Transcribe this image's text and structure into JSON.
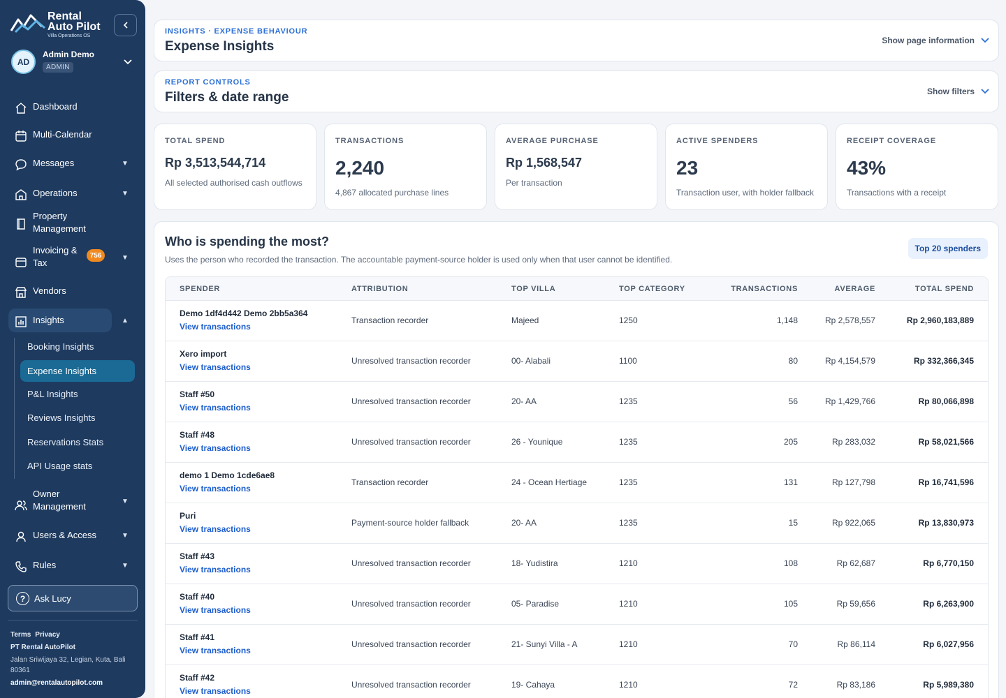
{
  "brand": {
    "line1": "Rental",
    "line2": "Auto Pilot",
    "tagline": "Villa Operations OS"
  },
  "user": {
    "initials": "AD",
    "name": "Admin Demo",
    "role": "ADMIN"
  },
  "nav": {
    "dashboard": "Dashboard",
    "multi_calendar": "Multi-Calendar",
    "messages": "Messages",
    "operations": "Operations",
    "property_management": "Property Management",
    "invoicing_line1": "Invoicing &",
    "invoicing_line2": "Tax",
    "invoicing_badge": "756",
    "vendors": "Vendors",
    "insights": "Insights",
    "owner_line1": "Owner",
    "owner_line2": "Management",
    "users_access": "Users & Access",
    "rules": "Rules",
    "caret_down": "▼",
    "caret_up": "▲"
  },
  "insights_sub": [
    "Booking Insights",
    "Expense Insights",
    "P&L Insights",
    "Reviews Insights",
    "Reservations Stats",
    "API Usage stats"
  ],
  "ask": {
    "icon": "?",
    "label": "Ask Lucy"
  },
  "footer": {
    "terms": "Terms",
    "privacy": "Privacy",
    "company": "PT Rental AutoPilot",
    "address": "Jalan Sriwijaya 32, Legian, Kuta, Bali 80361",
    "email": "admin@rentalautopilot.com"
  },
  "page": {
    "eyebrow": "INSIGHTS · EXPENSE BEHAVIOUR",
    "title": "Expense Insights",
    "info_toggle": "Show page information"
  },
  "filters": {
    "eyebrow": "REPORT CONTROLS",
    "title": "Filters & date range",
    "toggle": "Show filters"
  },
  "kpis": [
    {
      "label": "TOTAL SPEND",
      "value": "Rp 3,513,544,714",
      "sub": "All selected authorised cash outflows"
    },
    {
      "label": "TRANSACTIONS",
      "value": "2,240",
      "sub": "4,867 allocated purchase lines"
    },
    {
      "label": "AVERAGE PURCHASE",
      "value": "Rp 1,568,547",
      "sub": "Per transaction"
    },
    {
      "label": "ACTIVE SPENDERS",
      "value": "23",
      "sub": "Transaction user, with holder fallback"
    },
    {
      "label": "RECEIPT COVERAGE",
      "value": "43%",
      "sub": "Transactions with a receipt"
    }
  ],
  "spenders": {
    "title": "Who is spending the most?",
    "description": "Uses the person who recorded the transaction. The accountable payment-source holder is used only when that user cannot be identified.",
    "top_button": "Top 20 spenders",
    "link_label": "View transactions",
    "columns": [
      "SPENDER",
      "ATTRIBUTION",
      "TOP VILLA",
      "TOP CATEGORY",
      "TRANSACTIONS",
      "AVERAGE",
      "TOTAL SPEND"
    ],
    "rows": [
      {
        "spender": "Demo 1df4d442 Demo 2bb5a364",
        "attribution": "Transaction recorder",
        "villa": "Majeed",
        "category": "1250",
        "transactions": "1,148",
        "average": "Rp 2,578,557",
        "total": "Rp 2,960,183,889"
      },
      {
        "spender": "Xero import",
        "attribution": "Unresolved transaction recorder",
        "villa": "00- Alabali",
        "category": "1100",
        "transactions": "80",
        "average": "Rp 4,154,579",
        "total": "Rp 332,366,345"
      },
      {
        "spender": "Staff #50",
        "attribution": "Unresolved transaction recorder",
        "villa": "20- AA",
        "category": "1235",
        "transactions": "56",
        "average": "Rp 1,429,766",
        "total": "Rp 80,066,898"
      },
      {
        "spender": "Staff #48",
        "attribution": "Unresolved transaction recorder",
        "villa": "26 - Younique",
        "category": "1235",
        "transactions": "205",
        "average": "Rp 283,032",
        "total": "Rp 58,021,566"
      },
      {
        "spender": "demo 1 Demo 1cde6ae8",
        "attribution": "Transaction recorder",
        "villa": "24 - Ocean Hertiage",
        "category": "1235",
        "transactions": "131",
        "average": "Rp 127,798",
        "total": "Rp 16,741,596"
      },
      {
        "spender": "Puri",
        "attribution": "Payment-source holder fallback",
        "villa": "20- AA",
        "category": "1235",
        "transactions": "15",
        "average": "Rp 922,065",
        "total": "Rp 13,830,973"
      },
      {
        "spender": "Staff #43",
        "attribution": "Unresolved transaction recorder",
        "villa": "18- Yudistira",
        "category": "1210",
        "transactions": "108",
        "average": "Rp 62,687",
        "total": "Rp 6,770,150"
      },
      {
        "spender": "Staff #40",
        "attribution": "Unresolved transaction recorder",
        "villa": "05- Paradise",
        "category": "1210",
        "transactions": "105",
        "average": "Rp 59,656",
        "total": "Rp 6,263,900"
      },
      {
        "spender": "Staff #41",
        "attribution": "Unresolved transaction recorder",
        "villa": "21- Sunyi Villa - A",
        "category": "1210",
        "transactions": "70",
        "average": "Rp 86,114",
        "total": "Rp 6,027,956"
      },
      {
        "spender": "Staff #42",
        "attribution": "Unresolved transaction recorder",
        "villa": "19- Cahaya",
        "category": "1210",
        "transactions": "72",
        "average": "Rp 83,186",
        "total": "Rp 5,989,380"
      }
    ]
  },
  "colors": {
    "sidebar": "#1e3a5f",
    "accent": "#2b6fd6",
    "link": "#1f5fcc",
    "badge": "#f08a1f",
    "active_sub": "#1a6a95"
  }
}
